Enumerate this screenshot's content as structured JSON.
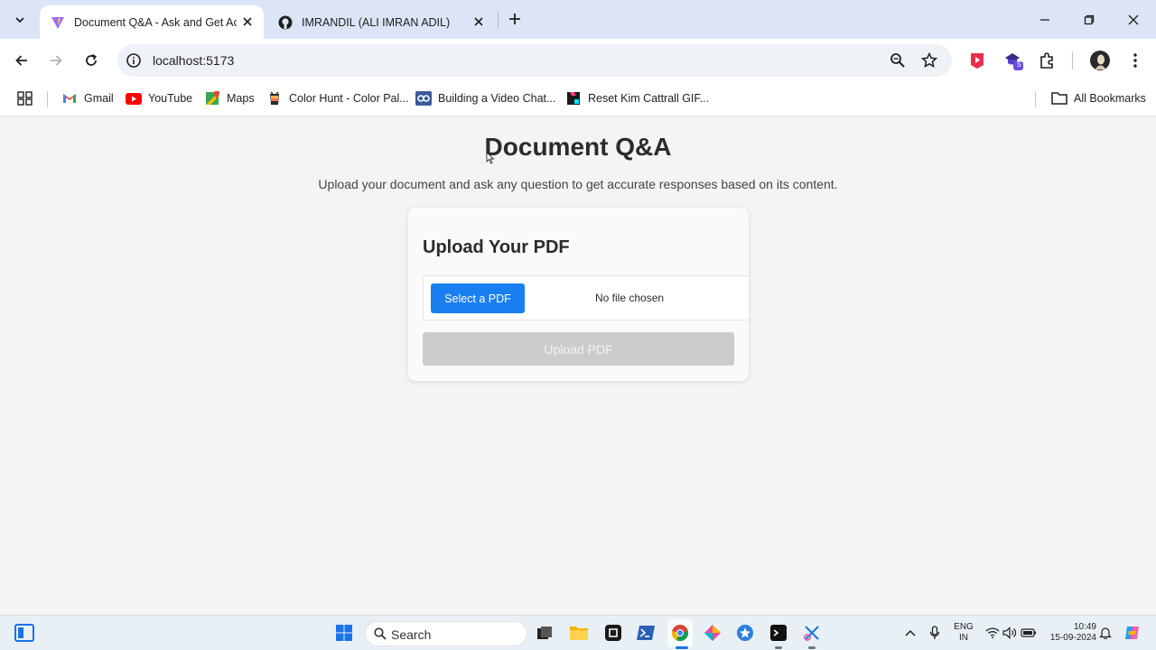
{
  "browser": {
    "tabs": [
      {
        "title": "Document Q&A - Ask and Get Acc",
        "active": true,
        "favicon": "vite-icon"
      },
      {
        "title": "IMRANDIL (ALI IMRAN ADIL)",
        "active": false,
        "favicon": "github-icon"
      }
    ],
    "url": "localhost:5173",
    "extension_badge": "5"
  },
  "bookmarks": {
    "items": [
      {
        "label": "Gmail",
        "icon": "gmail-icon"
      },
      {
        "label": "YouTube",
        "icon": "youtube-icon"
      },
      {
        "label": "Maps",
        "icon": "maps-icon"
      },
      {
        "label": "Color Hunt - Color Pal...",
        "icon": "colorhunt-icon"
      },
      {
        "label": "Building a Video Chat...",
        "icon": "video-chat-icon"
      },
      {
        "label": "Reset Kim Cattrall GIF...",
        "icon": "gif-icon"
      }
    ],
    "all_bookmarks": "All Bookmarks"
  },
  "page": {
    "title": "Document Q&A",
    "subtitle": "Upload your document and ask any question to get accurate responses based on its content.",
    "card": {
      "heading": "Upload Your PDF",
      "select_label": "Select a PDF",
      "file_status": "No file chosen",
      "upload_label": "Upload PDF"
    }
  },
  "taskbar": {
    "search_placeholder": "Search",
    "language": "ENG",
    "region": "IN",
    "time": "10:49",
    "date": "15-09-2024"
  },
  "colors": {
    "accent": "#1a7ff0",
    "disabled": "#cccccc",
    "tab_strip": "#dbe5f5"
  }
}
